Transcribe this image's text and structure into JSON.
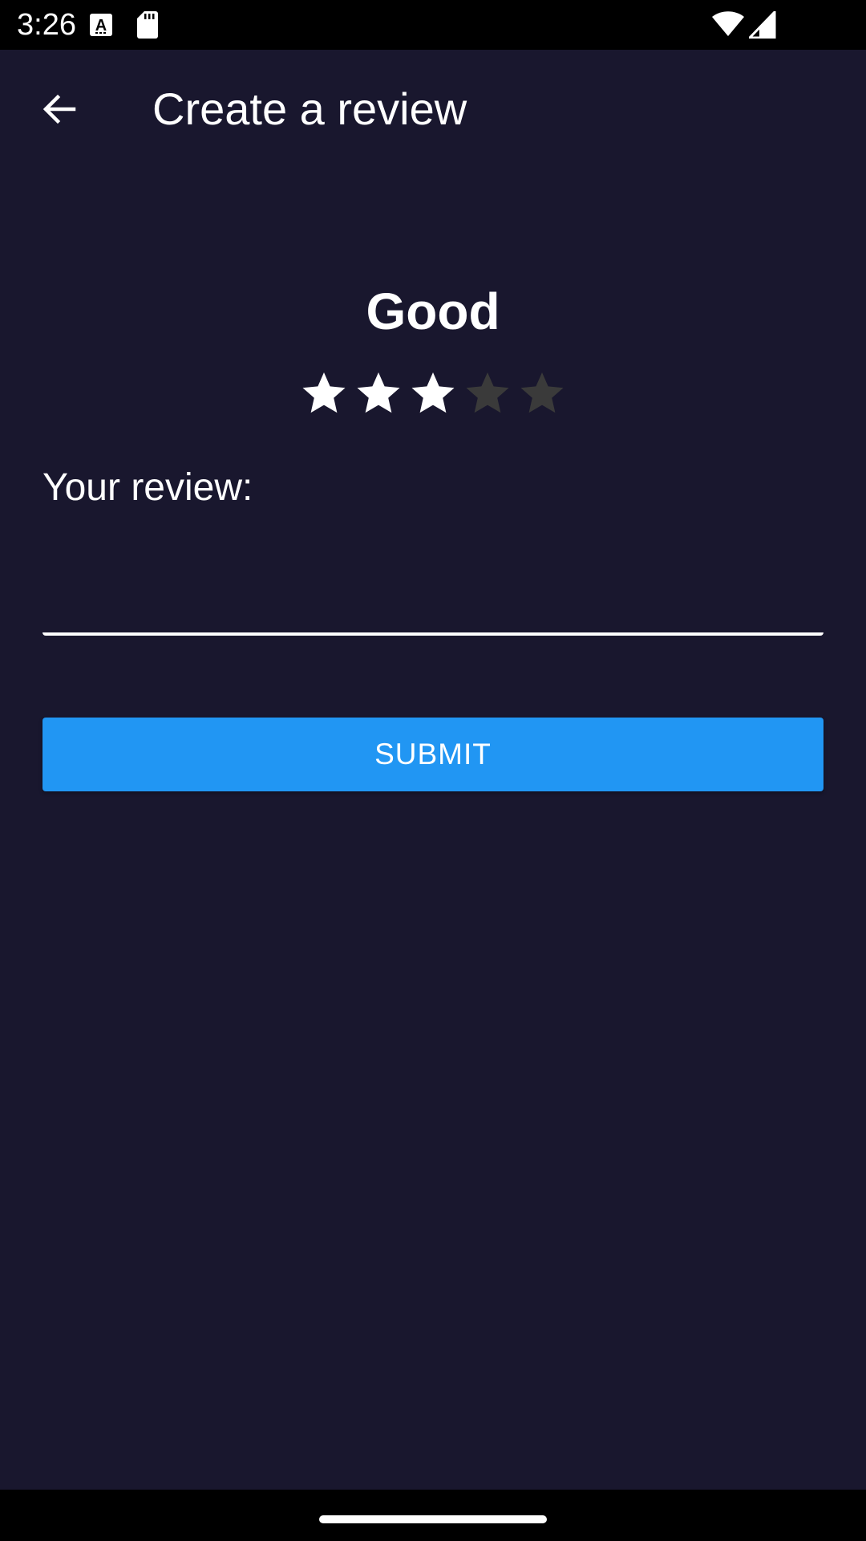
{
  "status_bar": {
    "time": "3:26",
    "icons": [
      "a-notification-icon",
      "sd-card-icon",
      "wifi-icon",
      "cell-signal-icon"
    ]
  },
  "app_bar": {
    "back_icon": "arrow-back-icon",
    "title": "Create a review"
  },
  "rating": {
    "label": "Good",
    "value": 3,
    "max": 5,
    "filled_color": "#ffffff",
    "empty_color": "#3a3a3a"
  },
  "review": {
    "label": "Your review:",
    "value": ""
  },
  "submit": {
    "label": "SUBMIT",
    "color": "#2196f3"
  },
  "colors": {
    "background": "#19172e",
    "system_bars": "#000000"
  }
}
